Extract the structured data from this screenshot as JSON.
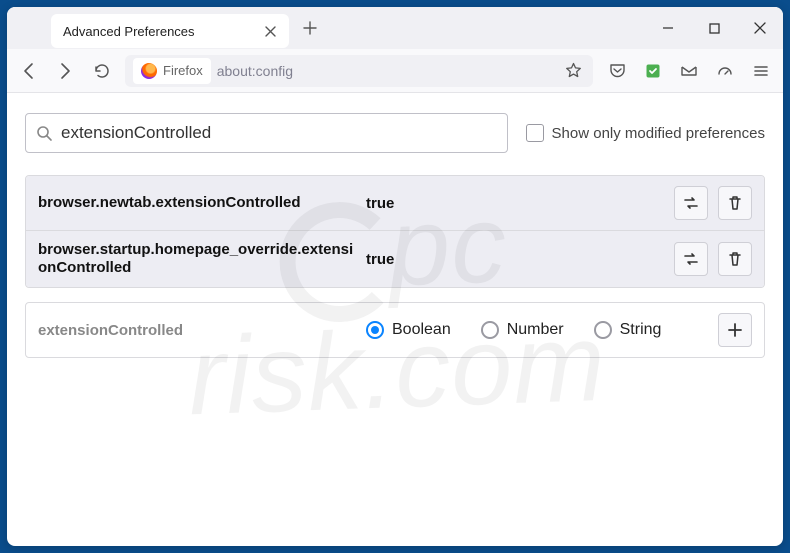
{
  "tab": {
    "title": "Advanced Preferences"
  },
  "url": {
    "identity": "Firefox",
    "address": "about:config"
  },
  "search": {
    "value": "extensionControlled",
    "checkbox_label": "Show only modified preferences",
    "checked": false
  },
  "prefs": [
    {
      "name": "browser.newtab.extensionControlled",
      "value": "true"
    },
    {
      "name": "browser.startup.homepage_override.extensionControlled",
      "value": "true"
    }
  ],
  "newpref": {
    "name": "extensionControlled",
    "types": [
      "Boolean",
      "Number",
      "String"
    ],
    "selected": "Boolean"
  },
  "watermark": {
    "line1": "pc",
    "line2": "risk.com"
  }
}
